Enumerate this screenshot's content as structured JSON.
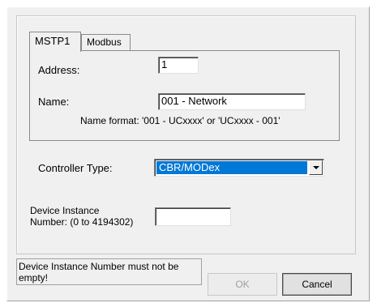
{
  "tabs": [
    {
      "label": "MSTP1",
      "active": true
    },
    {
      "label": "Modbus",
      "active": false
    }
  ],
  "mstp": {
    "address_label": "Address:",
    "address_value": "1",
    "name_label": "Name:",
    "name_value": "001 - Network",
    "name_hint": "Name format: '001 - UCxxxx' or 'UCxxxx - 001'"
  },
  "controller": {
    "label": "Controller Type:",
    "selected": "CBR/MODex"
  },
  "device_instance": {
    "label_line1": "Device Instance",
    "label_line2": "Number: (0 to 4194302)",
    "value": ""
  },
  "status": {
    "message": "Device Instance Number must not be empty!"
  },
  "buttons": {
    "ok_label": "OK",
    "ok_enabled": false,
    "cancel_label": "Cancel"
  },
  "colors": {
    "selection": "#0078d7",
    "dialog_bg": "#f0f0f0"
  }
}
